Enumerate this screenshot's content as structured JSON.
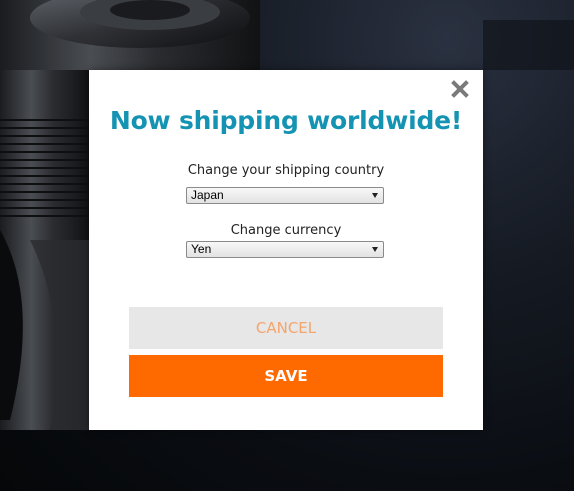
{
  "modal": {
    "title": "Now shipping worldwide!",
    "close_icon": "close-x-icon",
    "country": {
      "label": "Change your shipping country",
      "selected": "Japan"
    },
    "currency": {
      "label": "Change currency",
      "selected": "Yen"
    },
    "cancel_label": "CANCEL",
    "save_label": "SAVE"
  },
  "colors": {
    "title": "#1493b3",
    "save_bg": "#ff6a00",
    "cancel_bg": "#e7e7e7",
    "cancel_text": "#f5a46a",
    "close_icon": "#7a7a7a"
  },
  "background": {
    "image": "camera-lens-photo"
  }
}
